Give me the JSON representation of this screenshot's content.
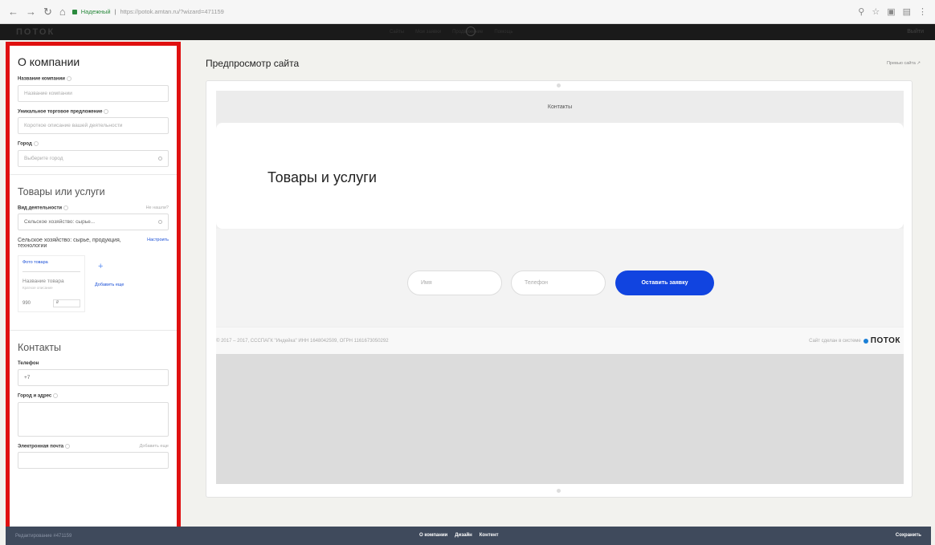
{
  "browser": {
    "secure_label": "Надежный",
    "url": "https://potok.amtan.ru/?wizard=471159"
  },
  "appbar": {
    "logo": "ПОТОК",
    "menu": [
      "Сайты",
      "Мои заявки",
      "Продвижение",
      "Помощь"
    ],
    "right": "Выйти"
  },
  "sidebar": {
    "company": {
      "title": "О компании",
      "name_label": "Название компании",
      "name_placeholder": "Название компании",
      "usp_label": "Уникальное торговое предложение",
      "usp_placeholder": "Короткое описание вашей деятельности",
      "city_label": "Город",
      "city_placeholder": "Выберите город"
    },
    "goods": {
      "title": "Товары или услуги",
      "activity_label": "Вид деятельности",
      "activity_aux": "Не нашли?",
      "activity_value": "Сельское хозяйство: сырье...",
      "category_title": "Сельское хозяйство: сырье, продукция, технологии",
      "setup_link": "Настроить",
      "card": {
        "upload": "Фото товара",
        "name": "Название товара",
        "desc": "Краткое описание",
        "price": "990",
        "currency": "₽"
      },
      "add_more": "Добавить еще"
    },
    "contacts": {
      "title": "Контакты",
      "phone_label": "Телефон",
      "phone_value": "+7",
      "address_label": "Город и адрес",
      "email_label": "Электронная почта",
      "email_aux": "Добавить еще"
    }
  },
  "main": {
    "title": "Предпросмотр сайта",
    "preview_link": "Превью сайта ↗",
    "preview": {
      "contacts_tab": "Контакты",
      "goods_title": "Товары и услуги",
      "name_placeholder": "Имя",
      "phone_placeholder": "Телефон",
      "submit_label": "Оставить заявку",
      "copyright": "© 2017 – 2017, СССПАГК \"Индейка\" ИНН 1648042509, ОГРН 1161673050292",
      "made_in": "Сайт сделан в системе",
      "brand": "ПОТОК"
    }
  },
  "bottombar": {
    "edit_label": "Редактирование #471159",
    "tabs": [
      "О компании",
      "Дизайн",
      "Контент"
    ],
    "save_label": "Сохранить"
  }
}
